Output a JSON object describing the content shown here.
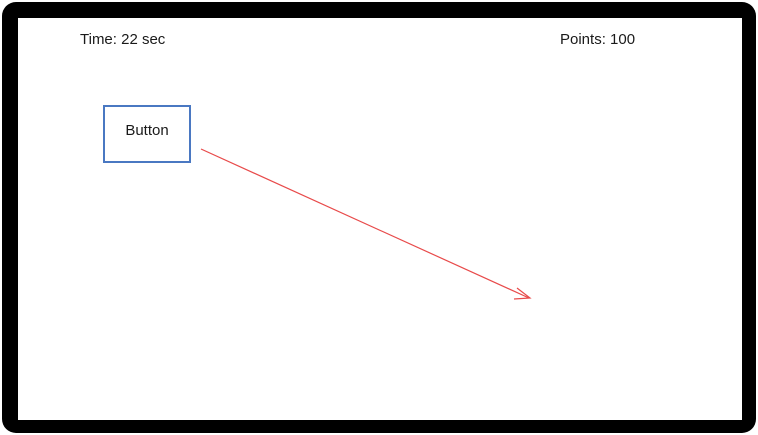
{
  "hud": {
    "time_label": "Time: 22 sec",
    "points_label": "Points: 100"
  },
  "game": {
    "button_label": "Button"
  },
  "colors": {
    "frame": "#000000",
    "button_border": "#4a78c2",
    "arrow": "#e84a4a"
  },
  "icons": {
    "arrow": "motion-arrow-icon"
  }
}
